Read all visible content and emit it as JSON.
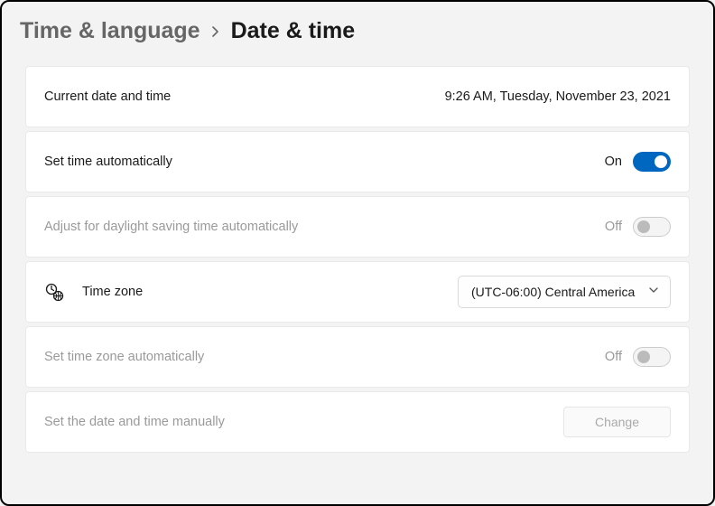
{
  "header": {
    "parent": "Time & language",
    "current": "Date & time"
  },
  "rows": {
    "current_datetime": {
      "label": "Current date and time",
      "value": "9:26 AM, Tuesday, November 23, 2021"
    },
    "set_time_auto": {
      "label": "Set time automatically",
      "state": "On"
    },
    "dst_auto": {
      "label": "Adjust for daylight saving time automatically",
      "state": "Off"
    },
    "time_zone": {
      "label": "Time zone",
      "selected": "(UTC-06:00) Central America"
    },
    "tz_auto": {
      "label": "Set time zone automatically",
      "state": "Off"
    },
    "manual": {
      "label": "Set the date and time manually",
      "button": "Change"
    }
  }
}
